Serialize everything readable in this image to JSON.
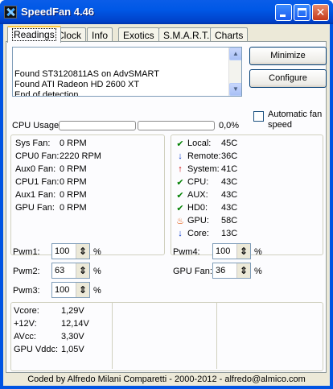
{
  "window": {
    "title": "SpeedFan 4.46"
  },
  "tabs": [
    "Readings",
    "Clock",
    "Info",
    "Exotics",
    "S.M.A.R.T.",
    "Charts"
  ],
  "log": {
    "text": "Found ST3120811AS on AdvSMART\nFound ATI Radeon HD 2600 XT\nEnd of detection"
  },
  "buttons": {
    "minimize": "Minimize",
    "configure": "Configure"
  },
  "auto_fan": {
    "label": "Automatic fan speed",
    "checked": false
  },
  "cpu_usage": {
    "label": "CPU Usage",
    "value": "0,0%",
    "bars": [
      0,
      0
    ]
  },
  "fans": [
    {
      "label": "Sys Fan:",
      "value": "0 RPM"
    },
    {
      "label": "CPU0 Fan:",
      "value": "2220 RPM"
    },
    {
      "label": "Aux0 Fan:",
      "value": "0 RPM"
    },
    {
      "label": "CPU1 Fan:",
      "value": "0 RPM"
    },
    {
      "label": "Aux1 Fan:",
      "value": "0 RPM"
    },
    {
      "label": "GPU Fan:",
      "value": "0 RPM"
    }
  ],
  "temps": [
    {
      "icon": "check-icon",
      "label": "Local:",
      "value": "45C",
      "color": "#008000"
    },
    {
      "icon": "arrow-down-icon",
      "label": "Remote:",
      "value": "36C",
      "color": "#0033cc"
    },
    {
      "icon": "arrow-up-icon",
      "label": "System:",
      "value": "41C",
      "color": "#cc0000"
    },
    {
      "icon": "check-icon",
      "label": "CPU:",
      "value": "43C",
      "color": "#008000"
    },
    {
      "icon": "check-icon",
      "label": "AUX:",
      "value": "43C",
      "color": "#008000"
    },
    {
      "icon": "check-icon",
      "label": "HD0:",
      "value": "43C",
      "color": "#008000"
    },
    {
      "icon": "flame-icon",
      "label": "GPU:",
      "value": "58C",
      "color": "#e05000"
    },
    {
      "icon": "arrow-down-icon",
      "label": "Core:",
      "value": "13C",
      "color": "#0033cc"
    }
  ],
  "pwm": [
    {
      "label": "Pwm1:",
      "value": "100",
      "unit": "%"
    },
    {
      "label": "Pwm2:",
      "value": "63",
      "unit": "%"
    },
    {
      "label": "Pwm3:",
      "value": "100",
      "unit": "%"
    },
    {
      "label": "Pwm4:",
      "value": "100",
      "unit": "%"
    },
    {
      "label": "GPU Fan:",
      "value": "36",
      "unit": "%"
    }
  ],
  "voltages": [
    {
      "label": "Vcore:",
      "value": "1,29V"
    },
    {
      "label": "+12V:",
      "value": "12,14V"
    },
    {
      "label": "AVcc:",
      "value": "3,30V"
    },
    {
      "label": "GPU Vddc:",
      "value": "1,05V"
    }
  ],
  "footer": "Coded by Alfredo Milani Comparetti - 2000-2012 - alfredo@almico.com",
  "colors": {
    "titlebar": "#0058e6",
    "face": "#ece9d8"
  }
}
